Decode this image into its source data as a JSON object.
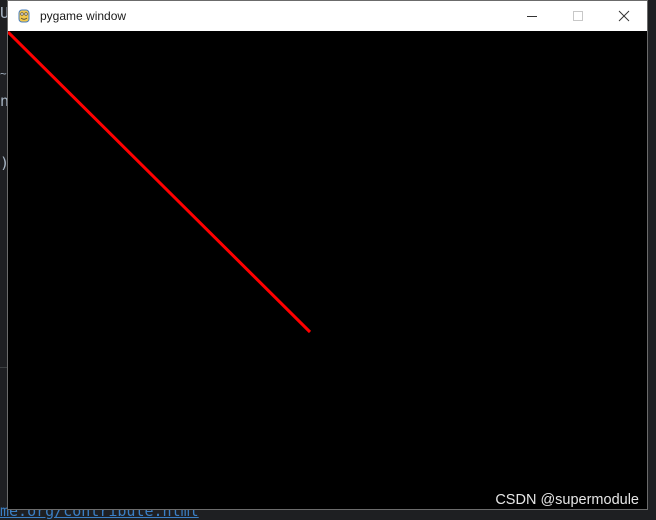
{
  "window": {
    "title": "pygame window"
  },
  "background": {
    "frag_top": "U",
    "frag_tilde": "~",
    "frag_n": "n",
    "frag_paren": ")",
    "url_text": "me.org/contribute.html"
  },
  "canvas": {
    "background_color": "#000000",
    "line_color": "#ff0000"
  },
  "watermark": "CSDN @supermodule"
}
